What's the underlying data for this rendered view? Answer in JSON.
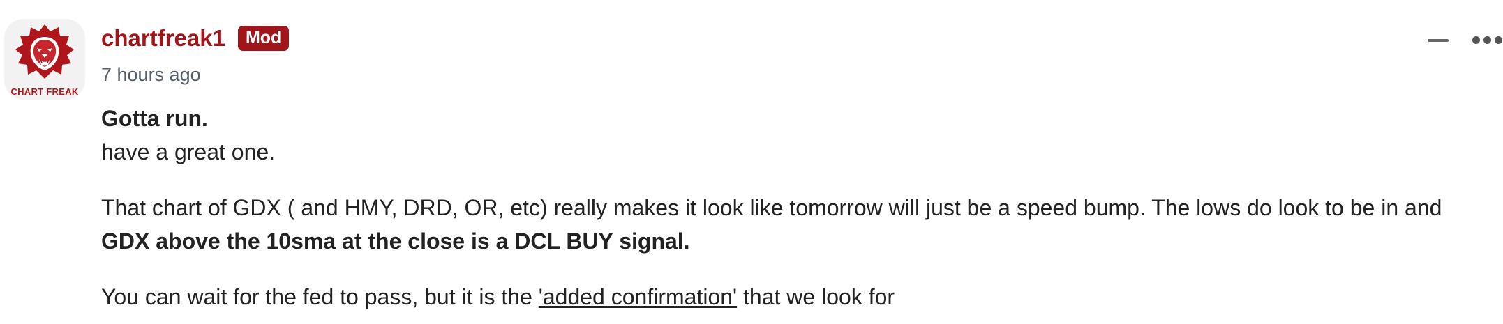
{
  "comment": {
    "avatar": {
      "caption": "CHART FREAK",
      "icon": "lion-head-icon",
      "brand_color": "#b0151b"
    },
    "author": {
      "name": "chartfreak1",
      "badge": "Mod",
      "color": "#a0151a"
    },
    "timestamp": "7 hours ago",
    "actions": {
      "collapse_icon": "minus-icon",
      "more_icon": "more-horizontal-icon"
    },
    "body": {
      "heading": "Gotta run.",
      "line1": "have a great one.",
      "para2_text": "That chart of GDX ( and HMY, DRD, OR, etc) really makes it look like tomorrow will just be a speed bump. The lows do look to be in and",
      "para2_bold": "GDX above the 10sma at the close is a DCL BUY signal.",
      "para3_before": "You can wait for the fed to pass, but it is the ",
      "para3_link": "'added confirmation'",
      "para3_after": " that we look for"
    }
  }
}
